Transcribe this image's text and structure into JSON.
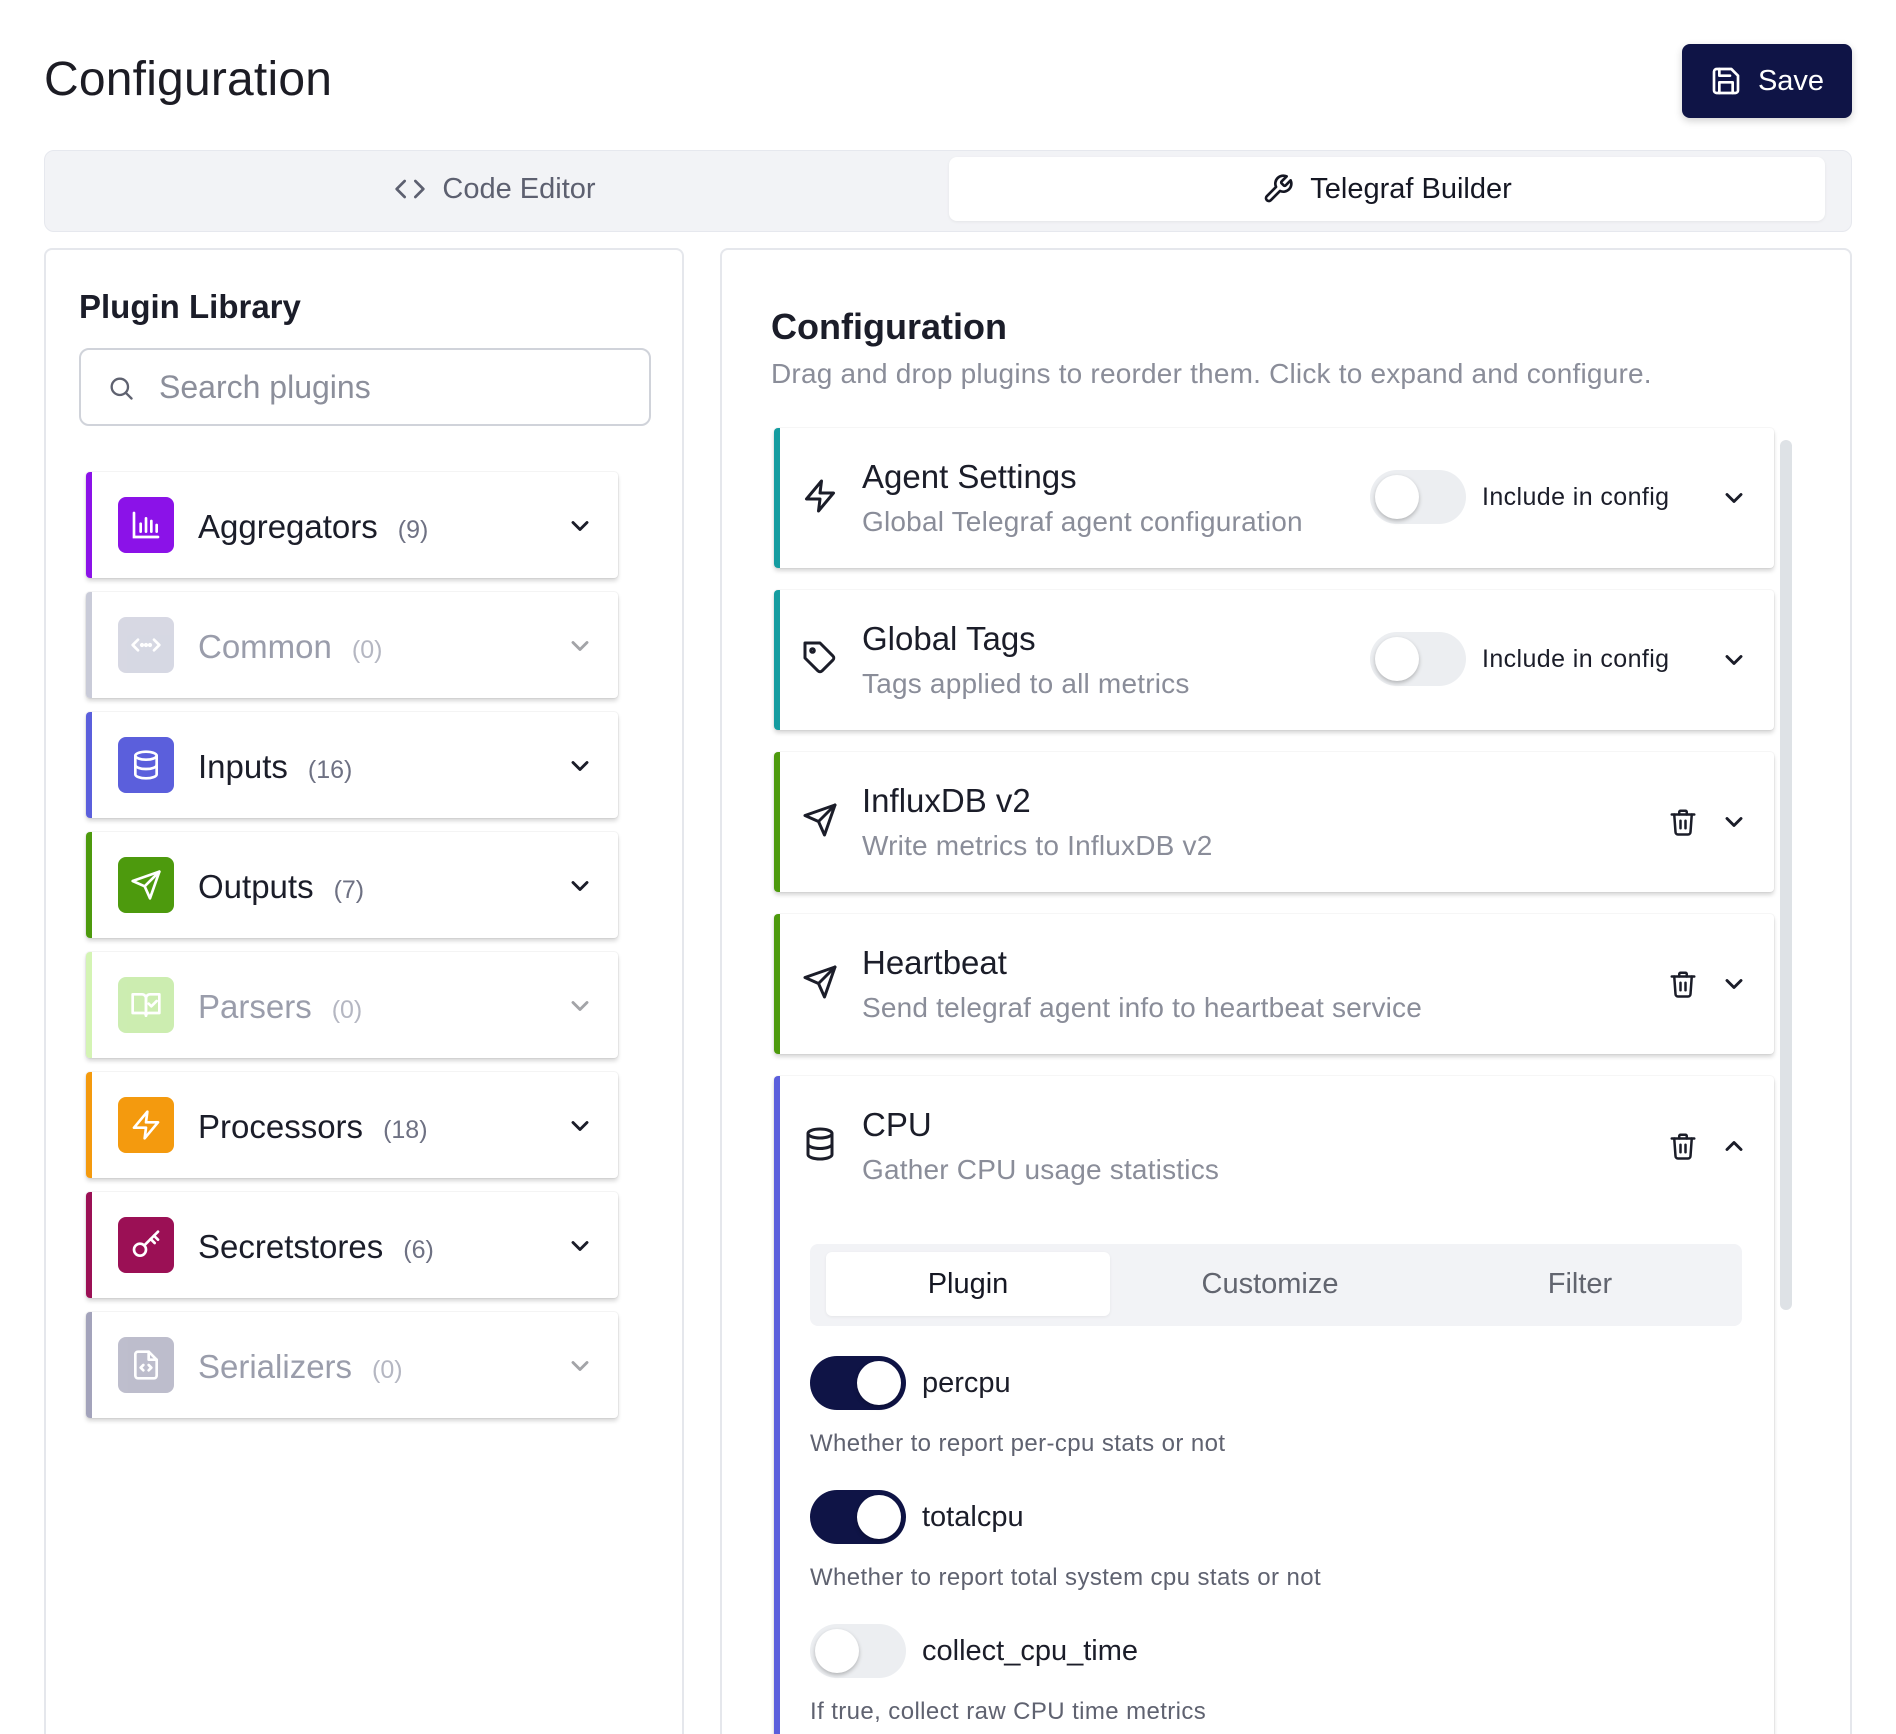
{
  "header": {
    "title": "Configuration",
    "save_label": "Save"
  },
  "mode_tabs": [
    {
      "label": "Code Editor",
      "icon": "code-icon",
      "active": false
    },
    {
      "label": "Telegraf Builder",
      "icon": "wrench-icon",
      "active": true
    }
  ],
  "library": {
    "title": "Plugin Library",
    "search_placeholder": "Search plugins",
    "categories": [
      {
        "name": "Aggregators",
        "count": "(9)",
        "color": "#8b12e8",
        "icon": "bar-chart-icon",
        "enabled": true
      },
      {
        "name": "Common",
        "count": "(0)",
        "color": "#a6a9c2",
        "icon": "code-dots-icon",
        "enabled": false
      },
      {
        "name": "Inputs",
        "count": "(16)",
        "color": "#5b5fdc",
        "icon": "database-icon",
        "enabled": true
      },
      {
        "name": "Outputs",
        "count": "(7)",
        "color": "#4d9a0d",
        "icon": "send-icon",
        "enabled": true
      },
      {
        "name": "Parsers",
        "count": "(0)",
        "color": "#b9ec8a",
        "icon": "book-icon",
        "enabled": false
      },
      {
        "name": "Processors",
        "count": "(18)",
        "color": "#f49a0e",
        "icon": "zap-icon",
        "enabled": true
      },
      {
        "name": "Secretstores",
        "count": "(6)",
        "color": "#9b1055",
        "icon": "key-icon",
        "enabled": true
      },
      {
        "name": "Serializers",
        "count": "(0)",
        "color": "#6e6e90",
        "icon": "file-code-icon",
        "enabled": false
      }
    ]
  },
  "config": {
    "title": "Configuration",
    "subtitle": "Drag and drop plugins to reorder them. Click to expand and configure.",
    "plugins": [
      {
        "title": "Agent Settings",
        "description": "Global Telegraf agent configuration",
        "icon": "zap-icon",
        "color": "#159ca0",
        "toggle_label": "Include in config",
        "included": false
      },
      {
        "title": "Global Tags",
        "description": "Tags applied to all metrics",
        "icon": "tag-icon",
        "color": "#159ca0",
        "toggle_label": "Include in config",
        "included": false
      },
      {
        "title": "InfluxDB v2",
        "description": "Write metrics to InfluxDB v2",
        "icon": "send-icon",
        "color": "#4d9a0d"
      },
      {
        "title": "Heartbeat",
        "description": "Send telegraf agent info to heartbeat service",
        "icon": "send-icon",
        "color": "#4d9a0d"
      },
      {
        "title": "CPU",
        "description": "Gather CPU usage statistics",
        "icon": "database-icon",
        "color": "#5b5fdc",
        "expanded": true
      }
    ],
    "detail_tabs": [
      "Plugin",
      "Customize",
      "Filter"
    ],
    "active_detail_tab": "Plugin",
    "options": [
      {
        "name": "percpu",
        "description": "Whether to report per-cpu stats or not",
        "enabled": true
      },
      {
        "name": "totalcpu",
        "description": "Whether to report total system cpu stats or not",
        "enabled": true
      },
      {
        "name": "collect_cpu_time",
        "description": "If true, collect raw CPU time metrics",
        "enabled": false
      }
    ]
  }
}
